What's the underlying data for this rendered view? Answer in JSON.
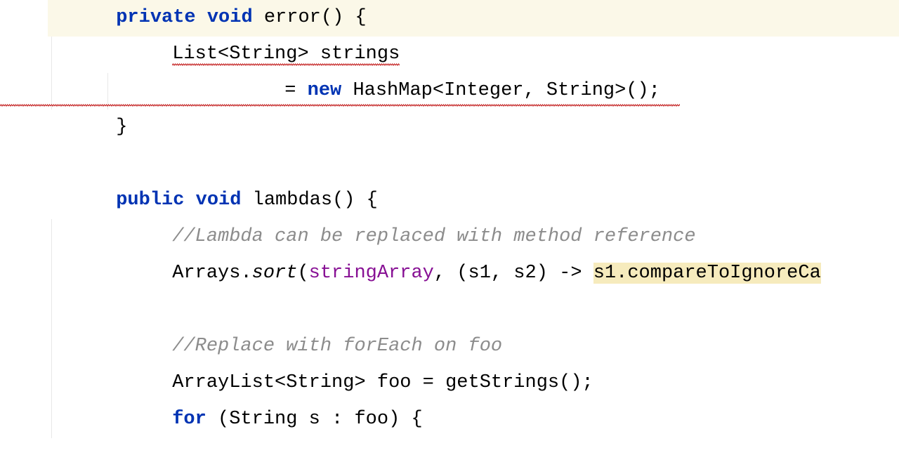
{
  "code": {
    "line1": {
      "kw_private": "private",
      "kw_void": "void",
      "method": "error",
      "parens": "()",
      "brace": " {"
    },
    "line2": {
      "type_list": "List",
      "angle_open": "<",
      "type_string": "String",
      "angle_close": ">",
      "space": " ",
      "var": "strings"
    },
    "line3": {
      "equals": "= ",
      "kw_new": "new",
      "space": " ",
      "type_hashmap": "HashMap",
      "angle_open": "<",
      "type_integer": "Integer",
      "comma": ", ",
      "type_string": "String",
      "angle_close": ">",
      "parens": "()",
      "semi": ";"
    },
    "line4": {
      "brace": "}"
    },
    "line6": {
      "kw_public": "public",
      "kw_void": "void",
      "method": "lambdas",
      "parens": "()",
      "brace": " {"
    },
    "line7": {
      "comment": "//Lambda can be replaced with method reference"
    },
    "line8": {
      "class": "Arrays",
      "dot": ".",
      "method": "sort",
      "paren_open": "(",
      "field": "stringArray",
      "comma": ", ",
      "lambda_params": "(s1, s2) -> ",
      "body_highlight": "s1.compareToIgnoreCa"
    },
    "line10": {
      "comment": "//Replace with forEach on foo"
    },
    "line11": {
      "type_arraylist": "ArrayList",
      "angle_open": "<",
      "type_string": "String",
      "angle_close": ">",
      "space": " ",
      "var": "foo",
      "equals": " = ",
      "method": "getStrings",
      "parens": "()",
      "semi": ";"
    },
    "line12": {
      "kw_for": "for",
      "space": " ",
      "paren_open": "(",
      "type_string": "String",
      "space2": " ",
      "var": "s",
      "colon": " : ",
      "iter": "foo",
      "paren_close": ")",
      "brace": " {"
    }
  }
}
